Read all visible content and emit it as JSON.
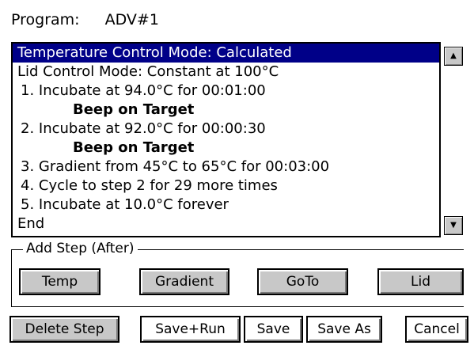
{
  "program": {
    "label": "Program:",
    "name": "ADV#1"
  },
  "step_list": {
    "selected_index": 0,
    "items": [
      "Temperature Control Mode: Calculated",
      "Lid Control Mode: Constant at 100°C",
      "1. Incubate at 94.0°C for 00:01:00",
      "Beep on Target",
      "2. Incubate at 92.0°C for 00:00:30",
      "Beep on Target",
      "3. Gradient from  45°C to  65°C for 00:03:00",
      "4. Cycle to step 2 for 29 more times",
      "5. Incubate at 10.0°C forever",
      "End"
    ]
  },
  "scroll": {
    "up_glyph": "▲",
    "down_glyph": "▼"
  },
  "add_step": {
    "legend": "Add Step (After)",
    "buttons": {
      "temp": "Temp",
      "gradient": "Gradient",
      "goto": "GoTo",
      "lid": "Lid"
    }
  },
  "actions": {
    "delete_step": "Delete Step",
    "save_run": "Save+Run",
    "save": "Save",
    "save_as": "Save As",
    "cancel": "Cancel"
  },
  "colors": {
    "selection": "#000088",
    "button_face": "#c8c8c8"
  }
}
